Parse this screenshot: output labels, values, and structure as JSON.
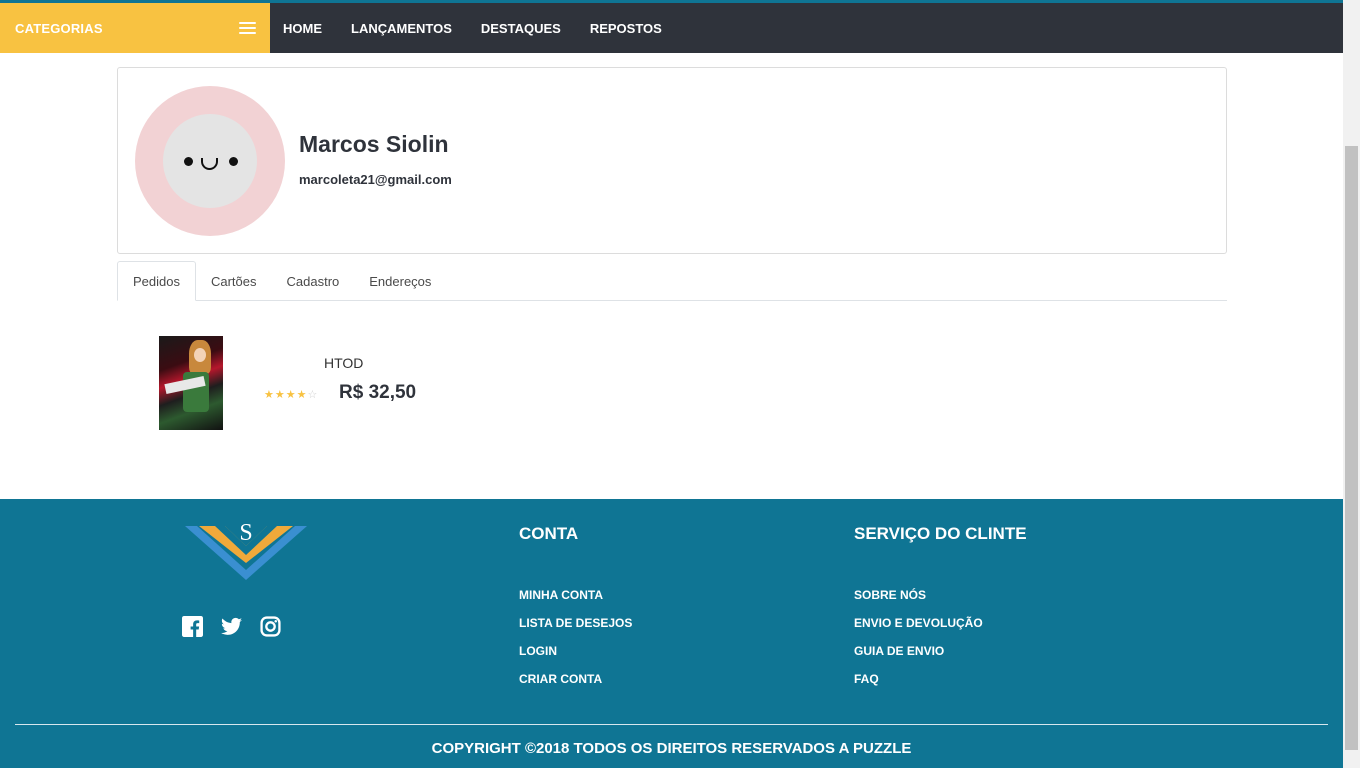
{
  "nav": {
    "categories_label": "CATEGORIAS",
    "links": [
      "HOME",
      "LANÇAMENTOS",
      "DESTAQUES",
      "REPOSTOS"
    ]
  },
  "profile": {
    "name": "Marcos Siolin",
    "email": "marcoleta21@gmail.com"
  },
  "tabs": [
    "Pedidos",
    "Cartões",
    "Cadastro",
    "Endereços"
  ],
  "active_tab": "Pedidos",
  "orders": [
    {
      "title": "HTOD",
      "price": "R$ 32,50",
      "rating": 4,
      "rating_max": 5
    }
  ],
  "footer": {
    "logo_letter": "S",
    "socials": [
      "facebook-icon",
      "twitter-icon",
      "instagram-icon"
    ],
    "conta": {
      "title": "CONTA",
      "links": [
        "MINHA CONTA",
        "LISTA DE DESEJOS",
        "LOGIN",
        "CRIAR CONTA"
      ]
    },
    "servico": {
      "title": "SERVIÇO DO CLINTE",
      "links": [
        "SOBRE NÓS",
        "ENVIO E DEVOLUÇÃO",
        "GUIA DE ENVIO",
        "FAQ"
      ]
    },
    "copyright": "COPYRIGHT ©2018 TODOS OS DIREITOS RESERVADOS A PUZZLE"
  },
  "colors": {
    "accent_yellow": "#f8c241",
    "navbar": "#2f333b",
    "footer": "#0f7594",
    "avatar_ring": "#f2d2d4"
  }
}
